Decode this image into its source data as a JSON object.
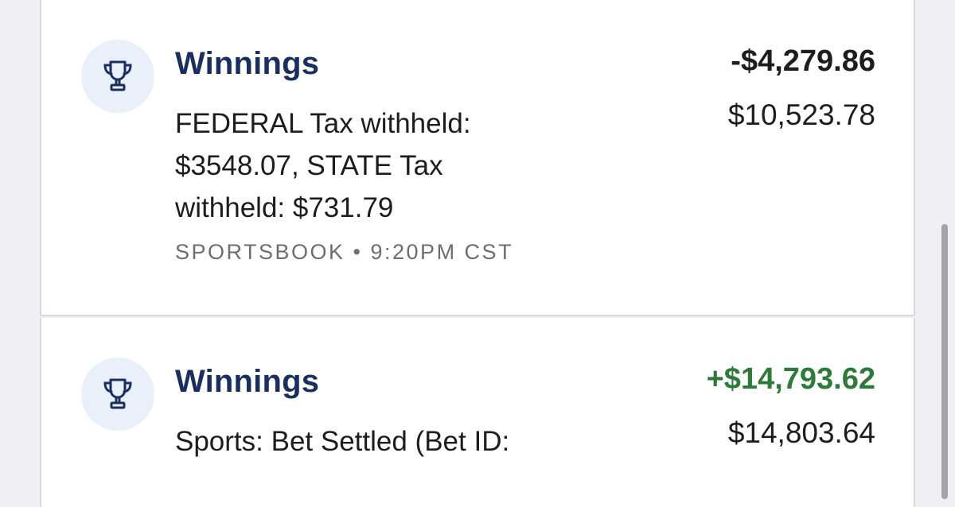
{
  "transactions": [
    {
      "title": "Winnings",
      "icon": "trophy-icon",
      "description": "FEDERAL Tax withheld: $3548.07, STATE Tax withheld: $731.79",
      "meta": "SPORTSBOOK • 9:20PM CST",
      "amount": "-$4,279.86",
      "amount_color": "#1d1d1f",
      "balance": "$10,523.78"
    },
    {
      "title": "Winnings",
      "icon": "trophy-icon",
      "description": "Sports: Bet Settled (Bet ID:",
      "amount": "+$14,793.62",
      "amount_color": "#2f7a3b",
      "balance": "$14,803.64"
    }
  ],
  "colors": {
    "title": "#1b2f5e",
    "icon_bg": "#e9f0fa",
    "positive": "#2f7a3b",
    "background": "#efeff4"
  }
}
